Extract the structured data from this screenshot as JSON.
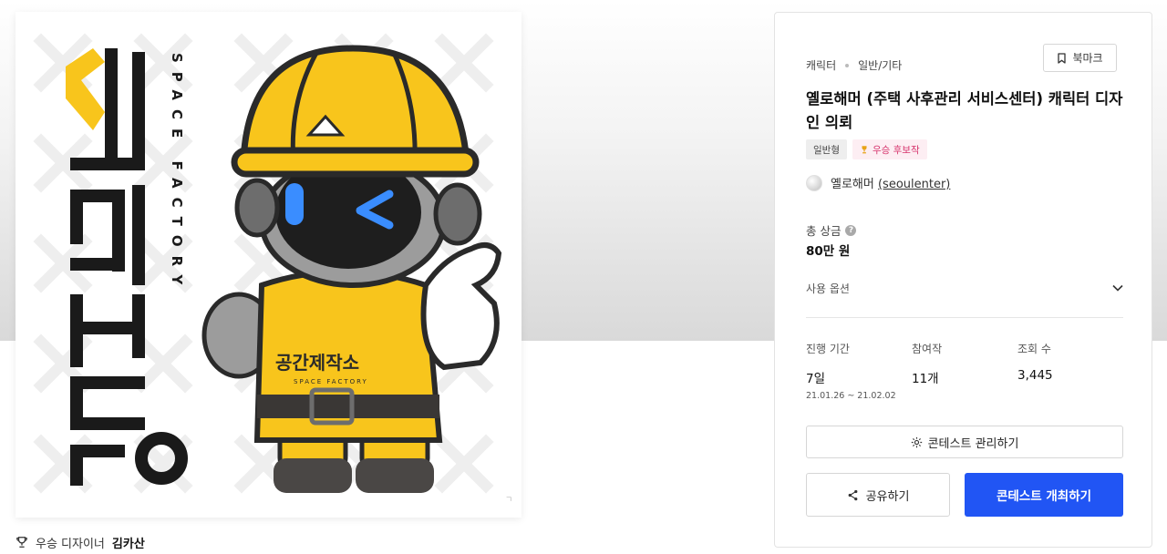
{
  "colors": {
    "brand_yellow": "#f8c51c",
    "brand_black": "#1a1a1a",
    "primary_button": "#2155f4",
    "award_tag_text": "#d6336c",
    "award_tag_bg": "#fdeef3"
  },
  "artwork": {
    "logo_text_vertical": "공간제작소",
    "logo_text_english": "SPACE FACTORY",
    "overall_badge_text": "공간제작소",
    "overall_badge_sub": "SPACE FACTORY"
  },
  "award": {
    "icon": "trophy-icon",
    "label": "우승 디자이너",
    "designer": "김카산"
  },
  "panel": {
    "category": "캐릭터",
    "subcategory": "일반/기타",
    "bookmark_label": "북마크",
    "title": "옐로해머 (주택 사후관리 서비스센터) 캐릭터 디자인 의뢰",
    "tags": {
      "type": "일반형",
      "award": "우승 후보작"
    },
    "owner": {
      "name": "옐로해머",
      "handle": "(seoulenter)"
    },
    "prize": {
      "label": "총 상금",
      "help": "?",
      "value": "80만 원"
    },
    "usage_label": "사용 옵션",
    "stats": {
      "period": {
        "label": "진행 기간",
        "value": "7일",
        "range": "21.01.26 ~ 21.02.02"
      },
      "entries": {
        "label": "참여작",
        "value": "11개"
      },
      "views": {
        "label": "조회 수",
        "value": "3,445"
      }
    },
    "buttons": {
      "manage": "콘테스트 관리하기",
      "share": "공유하기",
      "host": "콘테스트 개최하기"
    }
  }
}
